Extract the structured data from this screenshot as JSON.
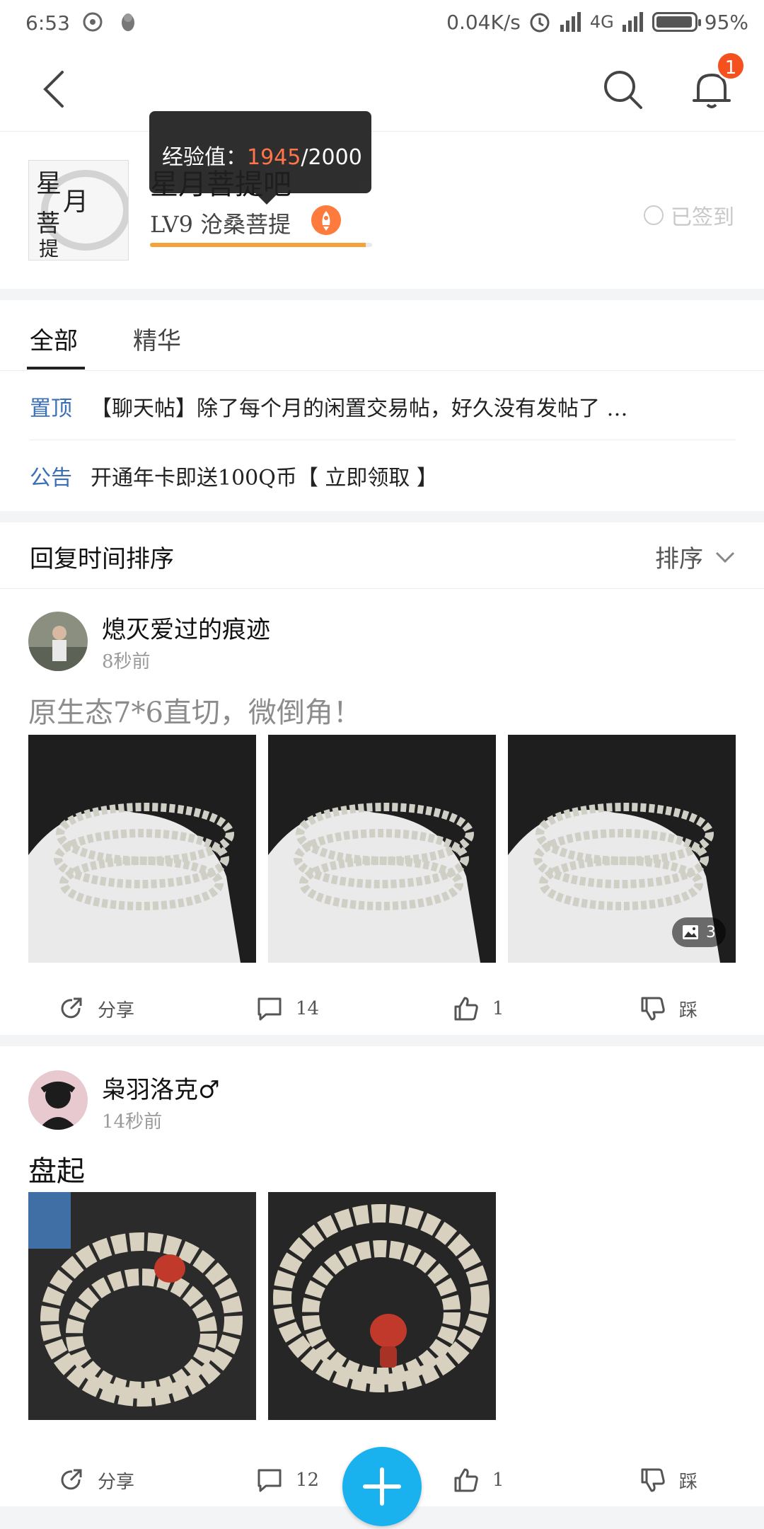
{
  "status_bar": {
    "time": "6:53",
    "net_speed": "0.04K/s",
    "network": "4G",
    "battery": "95%"
  },
  "nav": {
    "notification_count": "1",
    "icons": [
      "back-arrow-icon",
      "search-icon",
      "bell-icon"
    ]
  },
  "forum": {
    "name": "星月菩提吧",
    "level": "LV9 沧桑菩提",
    "signed_in": "已签到",
    "exp_label": "经验值：",
    "exp_current": "1945",
    "exp_total": "/2000",
    "exp_progress": 0.9725
  },
  "tabs": [
    {
      "label": "全部",
      "active": true
    },
    {
      "label": "精华",
      "active": false
    }
  ],
  "pinned": {
    "tag": "置顶",
    "text": "【聊天帖】除了每个月的闲置交易帖，好久没有发帖了 …"
  },
  "notice": {
    "tag": "公告",
    "text": "开通年卡即送100Q币【 立即领取 】"
  },
  "sort": {
    "title": "回复时间排序",
    "button": "排序"
  },
  "posts": [
    {
      "author": "熄灭爱过的痕迹",
      "time": "8秒前",
      "title": "原生态7*6直切，微倒角！",
      "image_count": "3",
      "share": "分享",
      "comments": "14",
      "likes": "1",
      "dislike": "踩"
    },
    {
      "author": "枭羽洛克♂",
      "time": "14秒前",
      "title": "盘起",
      "share": "分享",
      "comments": "12",
      "likes": "1",
      "dislike": "踩"
    }
  ],
  "colors": {
    "accent_blue": "#1ab2ee",
    "tag_blue": "#3a6fb7",
    "exp_orange": "#ff6a3d",
    "progress": "#f6a23a",
    "badge": "#f4511e"
  }
}
